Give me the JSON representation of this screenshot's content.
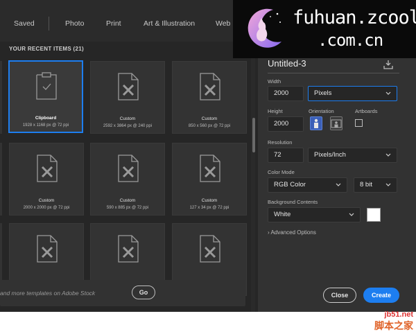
{
  "nav": {
    "tabs": [
      "Saved",
      "Photo",
      "Print",
      "Art & Illustration",
      "Web"
    ]
  },
  "recent": {
    "title": "YOUR RECENT ITEMS  (21)",
    "tiles": [
      {
        "name": "Clipboard",
        "dims": "1928 x 1168 px @ 72 ppi",
        "selected": true
      },
      {
        "name": "Custom",
        "dims": "2592 x 3864 px @ 240 ppi",
        "selected": false
      },
      {
        "name": "Custom",
        "dims": "850 x 560 px @ 72 ppi",
        "selected": false
      },
      {
        "name": "Custom",
        "dims": "2000 x 2000 px @ 72 ppi",
        "selected": false
      },
      {
        "name": "Custom",
        "dims": "590 x 885 px @ 72 ppi",
        "selected": false
      },
      {
        "name": "Custom",
        "dims": "127 x 34 px @ 72 ppi",
        "selected": false
      },
      {
        "name": "",
        "dims": "",
        "selected": false
      },
      {
        "name": "",
        "dims": "",
        "selected": false
      },
      {
        "name": "",
        "dims": "",
        "selected": false
      }
    ]
  },
  "stock": {
    "text": "and more templates on Adobe Stock",
    "go_label": "Go"
  },
  "preset": {
    "title": "Untitled-3",
    "width_label": "Width",
    "width_value": "2000",
    "width_unit": "Pixels",
    "height_label": "Height",
    "height_value": "2000",
    "orientation_label": "Orientation",
    "artboards_label": "Artboards",
    "resolution_label": "Resolution",
    "resolution_value": "72",
    "resolution_unit": "Pixels/Inch",
    "color_mode_label": "Color Mode",
    "color_mode_value": "RGB Color",
    "bit_depth_value": "8 bit",
    "bg_label": "Background Contents",
    "bg_value": "White",
    "advanced_label": "Advanced Options"
  },
  "actions": {
    "close_label": "Close",
    "create_label": "Create"
  },
  "watermark": {
    "line1": "fuhuan.zcool",
    "line2": ".com.cn",
    "corner1": "jb51.net",
    "corner2": "脚本之家"
  },
  "colors": {
    "accent": "#1d7ef0",
    "background": "#262626",
    "panel": "#323232",
    "tile": "#333333"
  }
}
